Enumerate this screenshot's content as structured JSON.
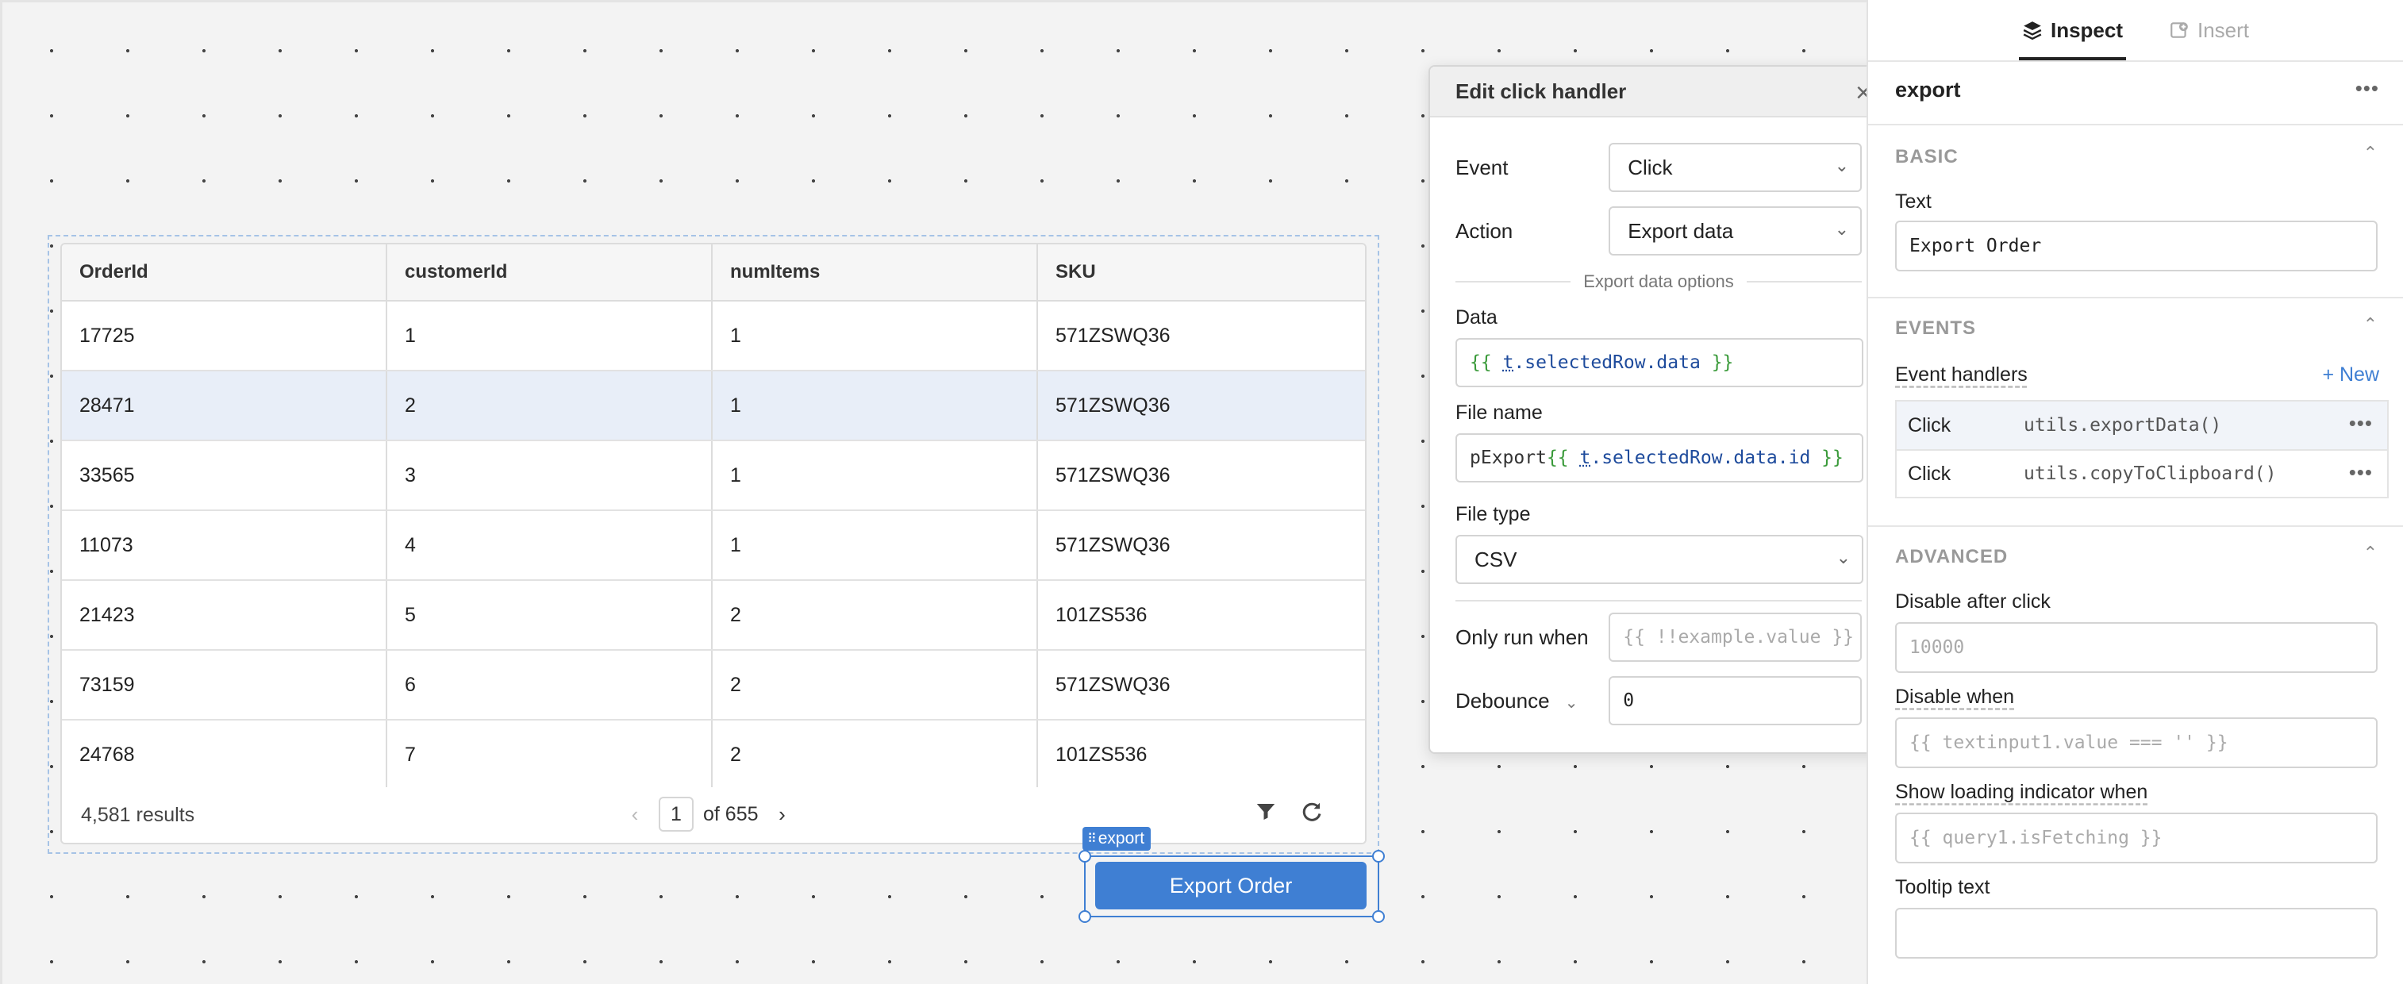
{
  "table": {
    "columns": [
      "OrderId",
      "customerId",
      "numItems",
      "SKU"
    ],
    "rows": [
      [
        "17725",
        "1",
        "1",
        "571ZSWQ36"
      ],
      [
        "28471",
        "2",
        "1",
        "571ZSWQ36"
      ],
      [
        "33565",
        "3",
        "1",
        "571ZSWQ36"
      ],
      [
        "11073",
        "4",
        "1",
        "571ZSWQ36"
      ],
      [
        "21423",
        "5",
        "2",
        "101ZS536"
      ],
      [
        "73159",
        "6",
        "2",
        "571ZSWQ36"
      ],
      [
        "24768",
        "7",
        "2",
        "101ZS536"
      ]
    ],
    "selected_row": 1,
    "footer": {
      "results": "4,581 results",
      "page": "1",
      "of_pages": "of 655",
      "prev_icon": "chevron-left-icon",
      "next_icon": "chevron-right-icon",
      "filter_icon": "filter-icon",
      "refresh_icon": "refresh-icon"
    }
  },
  "export_button": {
    "tag": "export",
    "label": "Export Order",
    "accent": "#3f7fd3"
  },
  "popup": {
    "title": "Edit click handler",
    "event_label": "Event",
    "event_value": "Click",
    "action_label": "Action",
    "action_value": "Export data",
    "section": "Export data options",
    "data_label": "Data",
    "data_value": {
      "open": "{{",
      "prefix": "t",
      "rest": ".selectedRow.data",
      "close": "}}"
    },
    "filename_label": "File name",
    "filename_value": {
      "plain": "pExport",
      "open": "{{",
      "prefix": "t",
      "rest": ".selectedRow.data.id",
      "close": "}}"
    },
    "filetype_label": "File type",
    "filetype_value": "CSV",
    "onlyrun_label": "Only run when",
    "onlyrun_placeholder": "{{ !!example.value }}",
    "debounce_label": "Debounce",
    "debounce_value": "0"
  },
  "panel": {
    "tabs": [
      {
        "label": "Inspect",
        "icon": "layers-icon"
      },
      {
        "label": "Insert",
        "icon": "insert-icon"
      }
    ],
    "component_name": "export",
    "basic": {
      "title": "BASIC",
      "text_label": "Text",
      "text_value": "Export Order"
    },
    "events": {
      "title": "EVENTS",
      "handlers_label": "Event handlers",
      "new_label": "+ New",
      "handlers": [
        {
          "type": "Click",
          "action": "utils.exportData()"
        },
        {
          "type": "Click",
          "action": "utils.copyToClipboard()"
        }
      ]
    },
    "advanced": {
      "title": "ADVANCED",
      "disable_after_label": "Disable after click",
      "disable_after_placeholder": "10000",
      "disable_when_label": "Disable when",
      "disable_when_placeholder": "{{ textinput1.value === '' }}",
      "loading_label": "Show loading indicator when",
      "loading_placeholder": "{{ query1.isFetching }}",
      "tooltip_label": "Tooltip text",
      "tooltip_value": ""
    }
  }
}
